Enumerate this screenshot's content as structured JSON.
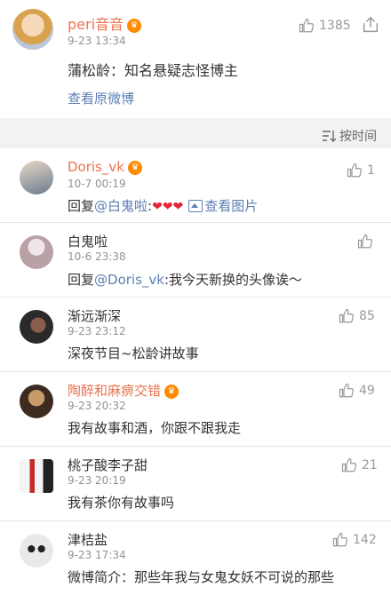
{
  "post": {
    "username": "peri音音",
    "time": "9-23 13:34",
    "likes": "1385",
    "text": "蒲松龄：知名悬疑志怪博主",
    "view_original": "查看原微博"
  },
  "sort": {
    "label": "按时间"
  },
  "comments": [
    {
      "username": "Doris_vk",
      "time": "10-7 00:19",
      "likes": "1",
      "reply_prefix": "回复",
      "mention": "@白鬼啦",
      "after_mention": ":",
      "hearts": "❤❤❤",
      "image_link": "查看图片",
      "avatar_colors": [
        "#e8d9c7",
        "#6a7b8c"
      ]
    },
    {
      "username": "白鬼啦",
      "time": "10-6 23:38",
      "likes": "",
      "reply_prefix": "回复",
      "mention": "@Doris_vk",
      "text": ":我今天新换的头像诶～",
      "avatar_colors": [
        "#b9a1a6",
        "#f0e6e9"
      ]
    },
    {
      "username": "渐远渐深",
      "time": "9-23 23:12",
      "likes": "85",
      "text": "深夜节目~松龄讲故事",
      "avatar_colors": [
        "#2a2a2a",
        "#8a5c4a"
      ]
    },
    {
      "username": "陶醉和麻痹交错",
      "time": "9-23 20:32",
      "likes": "49",
      "text": "我有故事和酒，你跟不跟我走",
      "avatar_colors": [
        "#c89b6b",
        "#3d2b20"
      ]
    },
    {
      "username": "桃子酸李子甜",
      "time": "9-23 20:19",
      "likes": "21",
      "text": "我有茶你有故事吗",
      "avatar_colors": [
        "#f4f4f4",
        "#c52b2b"
      ]
    },
    {
      "username": "津桔盐",
      "time": "9-23 17:34",
      "likes": "142",
      "text": "微博简介：那些年我与女鬼女妖不可说的那些",
      "avatar_colors": [
        "#e9e9e9",
        "#222222"
      ]
    }
  ],
  "colors": {
    "name_orange": "#eb7350",
    "link_blue": "#5b7fb4",
    "meta_gray": "#939393"
  },
  "icons": [
    "thumbs-up-icon",
    "share-icon",
    "sort-icon",
    "image-icon",
    "vip-badge-icon"
  ]
}
